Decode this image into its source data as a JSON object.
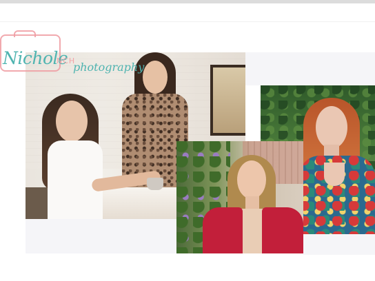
{
  "brand": {
    "name": "Nichole",
    "monogram": "NCH",
    "tagline": "photography",
    "colors": {
      "teal": "#4fb4b0",
      "pink": "#ef9aa0"
    },
    "icon": "camera-outline-icon"
  },
  "gallery": {
    "photos": [
      {
        "subject": "two-women-at-table"
      },
      {
        "subject": "red-haired-woman-floral-top"
      },
      {
        "subject": "blonde-woman-red-blazer"
      }
    ]
  }
}
